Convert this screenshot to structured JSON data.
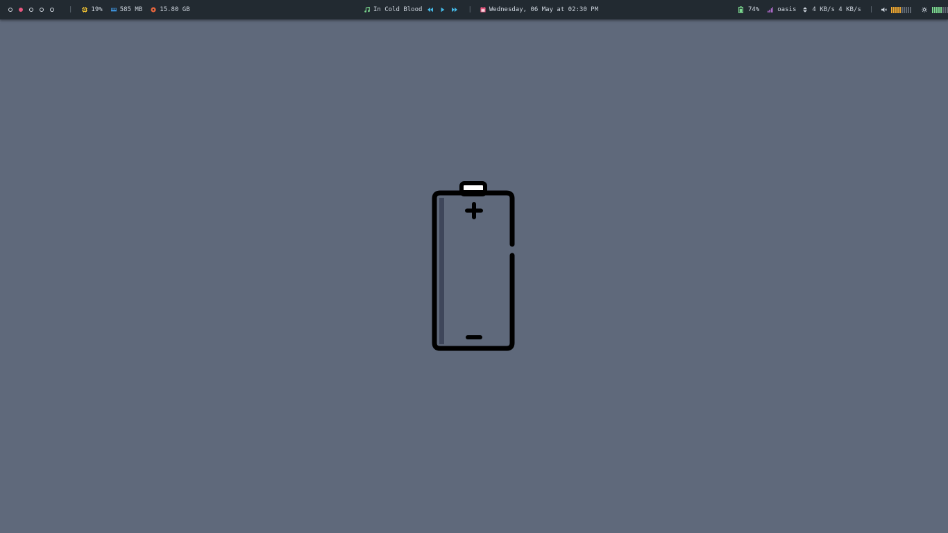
{
  "topbar": {
    "workspaces": [
      {
        "active": false
      },
      {
        "active": true
      },
      {
        "active": false
      },
      {
        "active": false
      },
      {
        "active": false
      }
    ],
    "separator": "|",
    "cpu": {
      "value": "19%",
      "icon": "cpu-chip-icon",
      "color": "#f1c232"
    },
    "memory": {
      "value": "585 MB",
      "icon": "memory-icon",
      "color": "#3d8fd6"
    },
    "disk": {
      "value": "15.80 GB",
      "icon": "disk-icon",
      "color": "#e8663d"
    },
    "music": {
      "title": "In Cold Blood",
      "icon": "music-note-icon",
      "icon_color": "#7bd88f",
      "controls_color": "#45b9e6"
    },
    "date": {
      "text": "Wednesday, 06 May at 02:30 PM",
      "icon": "calendar-icon",
      "icon_color": "#e8577f"
    },
    "battery": {
      "value": "74%",
      "icon": "battery-icon",
      "color": "#7bd88f"
    },
    "network": {
      "ssid": "oasis",
      "icon": "wifi-signal-icon",
      "icon_color": "#b86fd6",
      "rates": "4 KB/s 4 KB/s"
    },
    "volume": {
      "icon": "speaker-icon",
      "level": 0.5,
      "color": "#f0a830"
    },
    "brightness": {
      "icon": "brightness-icon",
      "level": 0.5,
      "color": "#7bd88f"
    }
  },
  "colors": {
    "desktop": "#5f697b",
    "bar": "#222a31",
    "battery_outline": "#000000",
    "battery_shade": "#3e465a"
  }
}
